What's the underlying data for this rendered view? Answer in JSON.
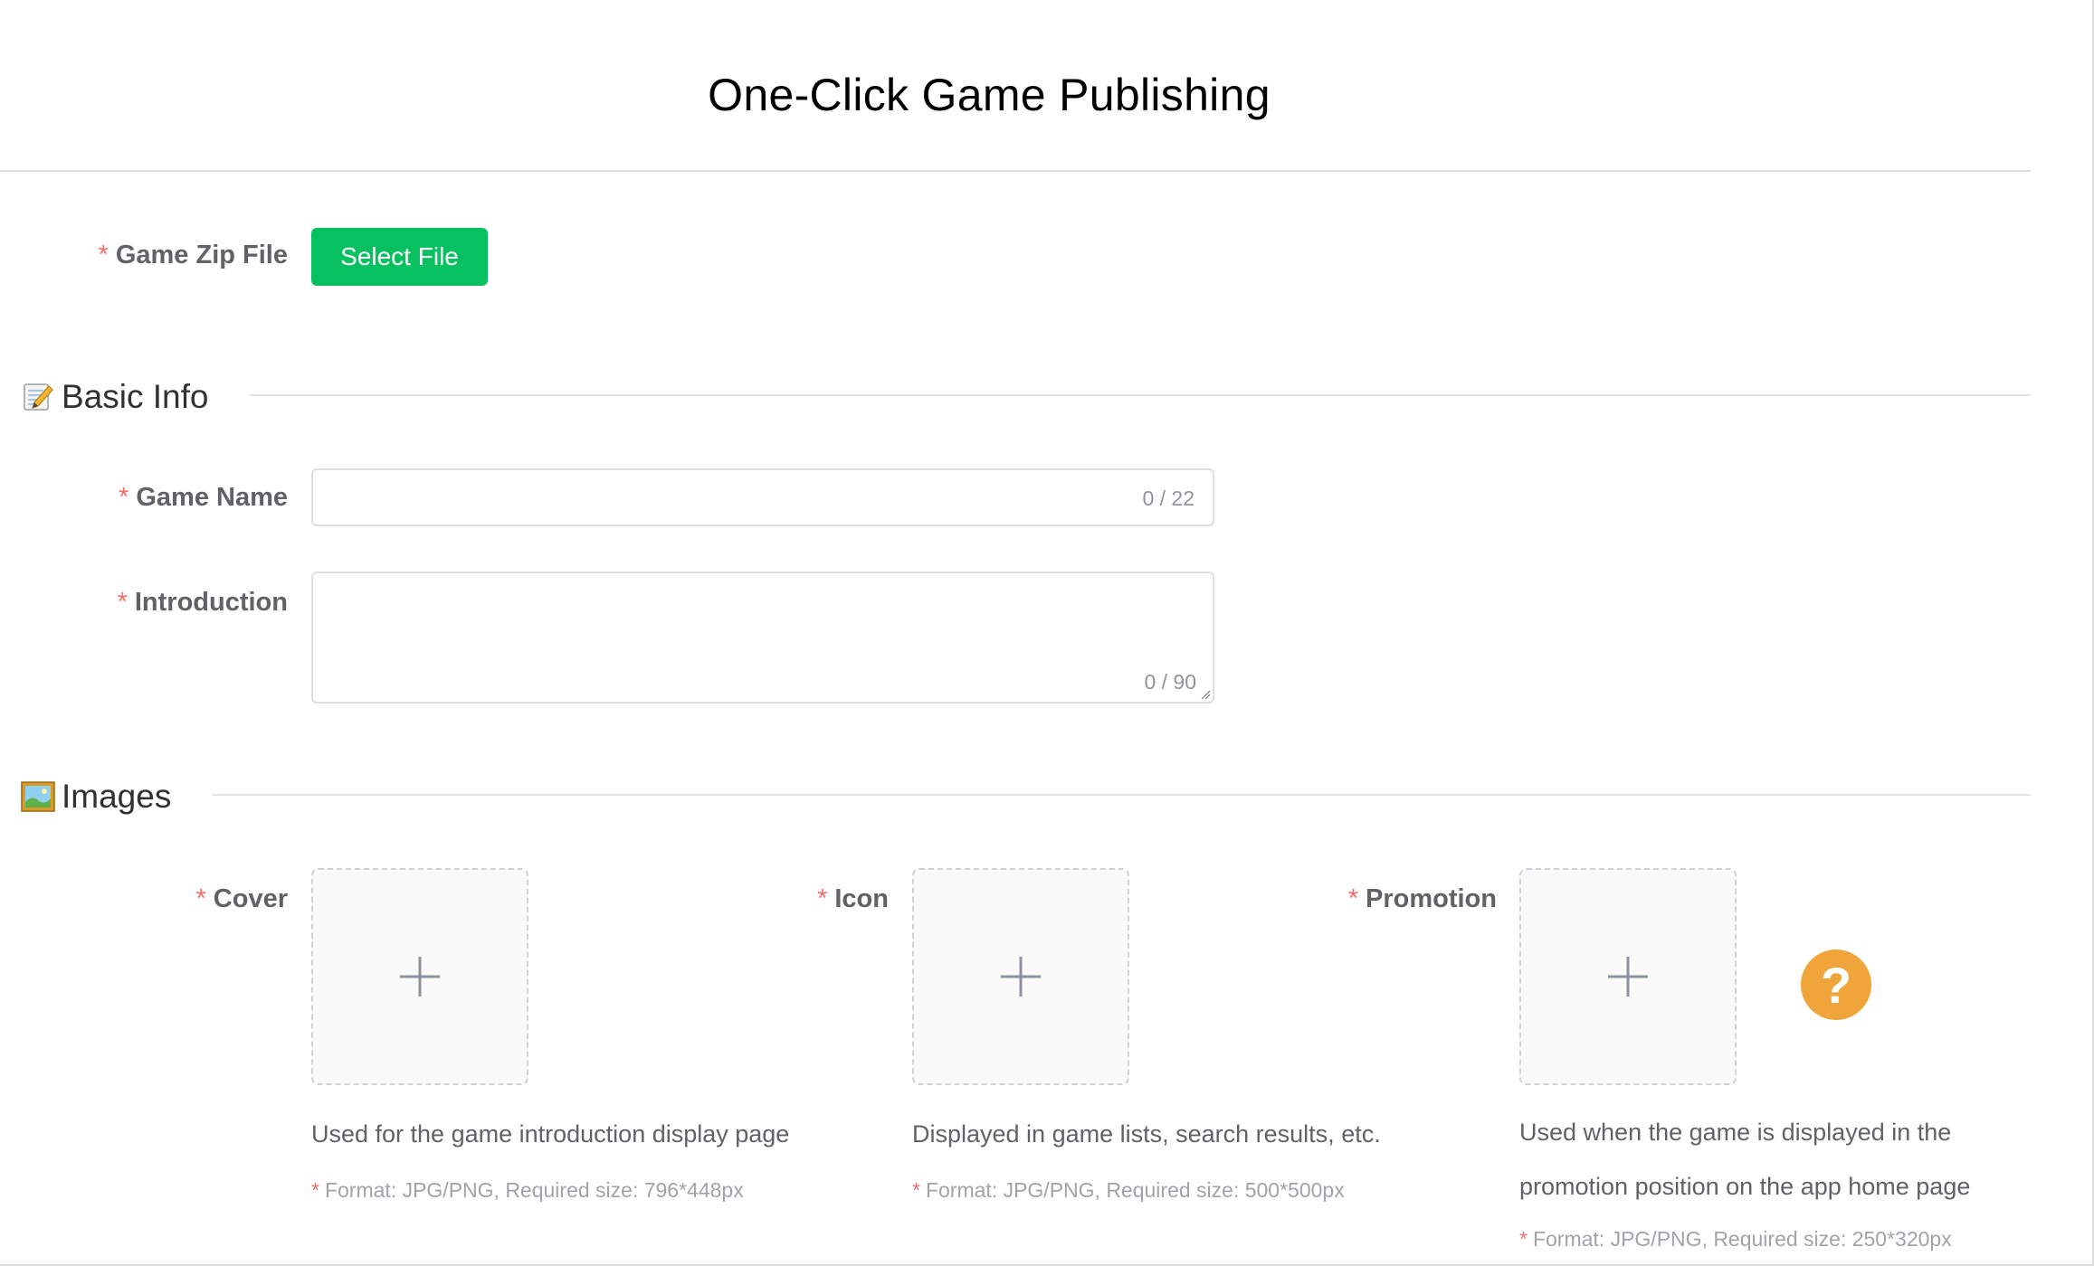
{
  "header": {
    "title": "One-Click Game Publishing"
  },
  "zip": {
    "required_mark": "*",
    "label": "Game Zip File",
    "button_label": "Select File"
  },
  "basic_info": {
    "icon": "memo-icon",
    "title": "Basic Info",
    "game_name": {
      "required_mark": "*",
      "label": "Game Name",
      "value": "",
      "counter": "0 / 22"
    },
    "introduction": {
      "required_mark": "*",
      "label": "Introduction",
      "value": "",
      "counter": "0 / 90"
    }
  },
  "images": {
    "icon": "framed-picture-icon",
    "title": "Images",
    "cover": {
      "required_mark": "*",
      "label": "Cover",
      "description": "Used for the game introduction display page",
      "hint_mark": "*",
      "hint": "Format: JPG/PNG, Required size: 796*448px"
    },
    "icon_upload": {
      "required_mark": "*",
      "label": "Icon",
      "description": "Displayed in game lists, search results, etc.",
      "hint_mark": "*",
      "hint": "Format: JPG/PNG, Required size: 500*500px"
    },
    "promotion": {
      "required_mark": "*",
      "label": "Promotion",
      "description": "Used when the game is displayed in the promotion position on the app home page",
      "hint_mark": "*",
      "hint": "Format: JPG/PNG, Required size: 250*320px"
    },
    "help_glyph": "?"
  },
  "colors": {
    "primary_button": "#07c160",
    "required": "#f56c6c",
    "help_icon": "#f0a53a"
  }
}
